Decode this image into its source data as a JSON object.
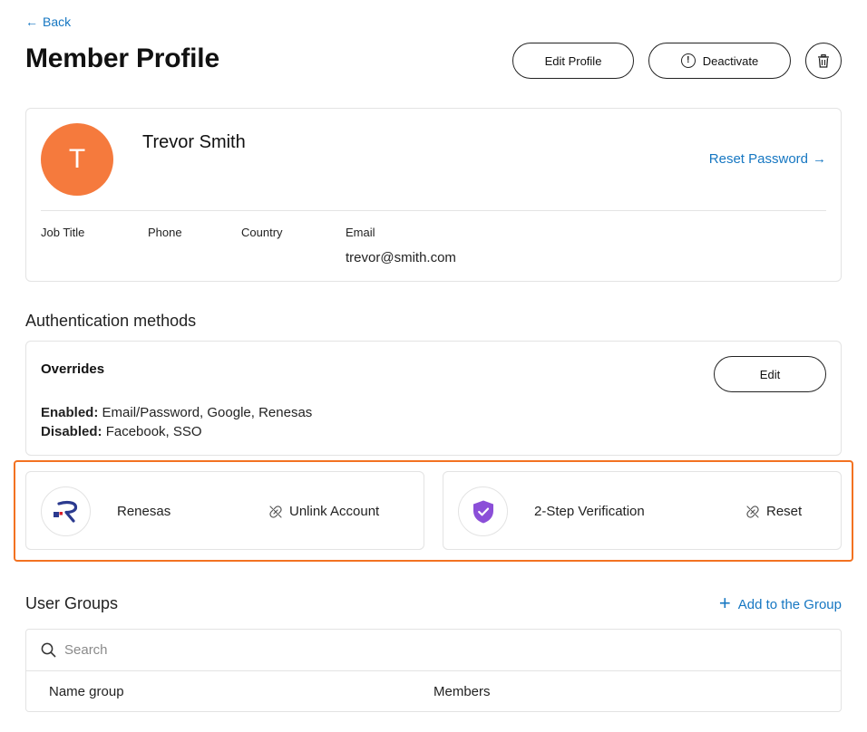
{
  "back": {
    "label": "Back"
  },
  "page": {
    "title": "Member Profile"
  },
  "header_actions": {
    "edit_profile": "Edit Profile",
    "deactivate": "Deactivate"
  },
  "profile": {
    "avatar_initial": "T",
    "avatar_color": "#f57a3d",
    "name": "Trevor Smith",
    "reset_password": "Reset Password",
    "fields": {
      "job_title_label": "Job Title",
      "phone_label": "Phone",
      "country_label": "Country",
      "email_label": "Email",
      "email_value": "trevor@smith.com"
    }
  },
  "auth": {
    "section_title": "Authentication methods",
    "overrides_title": "Overrides",
    "edit_label": "Edit",
    "enabled_label": "Enabled:",
    "enabled_value": "Email/Password, Google, Renesas",
    "disabled_label": "Disabled:",
    "disabled_value": "Facebook, SSO"
  },
  "methods": {
    "renesas": {
      "name": "Renesas",
      "action": "Unlink Account",
      "logo_icon": "renesas-logo"
    },
    "two_step": {
      "name": "2-Step Verification",
      "action": "Reset",
      "logo_icon": "shield-check-icon"
    },
    "highlight_color": "#f37221"
  },
  "groups": {
    "section_title": "User Groups",
    "add_label": "Add to the Group",
    "search_placeholder": "Search",
    "columns": [
      "Name group",
      "Members"
    ]
  },
  "colors": {
    "link": "#1677c2",
    "shield": "#8b4fd8"
  }
}
